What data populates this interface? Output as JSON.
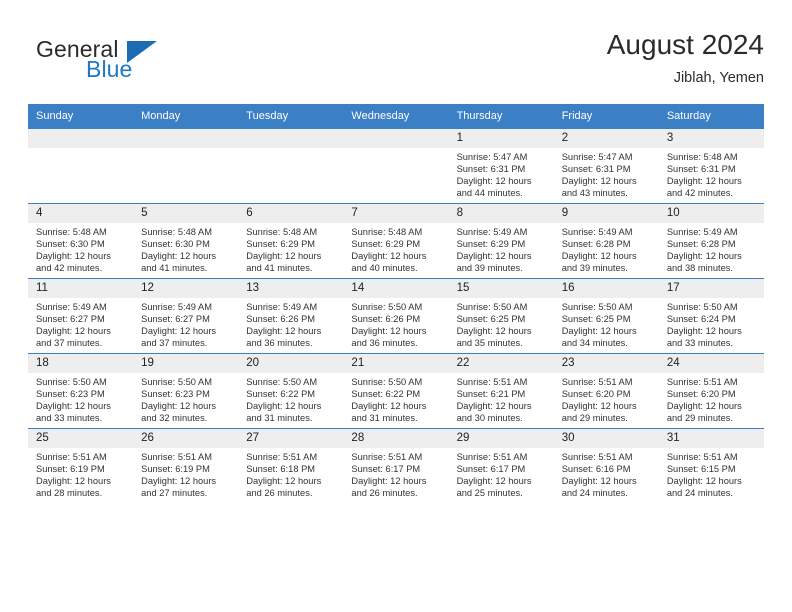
{
  "brand": {
    "name_line1": "General",
    "name_line2": "Blue",
    "flag_icon": "triangle-flag-icon",
    "color_primary": "#1b6cb3",
    "color_text": "#2b2b2b"
  },
  "header": {
    "title": "August 2024",
    "subtitle": "Jiblah, Yemen"
  },
  "calendar": {
    "header_bg": "#3b7fc4",
    "header_text_color": "#ffffff",
    "daynum_bg": "#eeeeee",
    "weekdays": [
      "Sunday",
      "Monday",
      "Tuesday",
      "Wednesday",
      "Thursday",
      "Friday",
      "Saturday"
    ],
    "weeks": [
      [
        {
          "day": "",
          "sunrise": "",
          "sunset": "",
          "daylight1": "",
          "daylight2": ""
        },
        {
          "day": "",
          "sunrise": "",
          "sunset": "",
          "daylight1": "",
          "daylight2": ""
        },
        {
          "day": "",
          "sunrise": "",
          "sunset": "",
          "daylight1": "",
          "daylight2": ""
        },
        {
          "day": "",
          "sunrise": "",
          "sunset": "",
          "daylight1": "",
          "daylight2": ""
        },
        {
          "day": "1",
          "sunrise": "Sunrise: 5:47 AM",
          "sunset": "Sunset: 6:31 PM",
          "daylight1": "Daylight: 12 hours",
          "daylight2": "and 44 minutes."
        },
        {
          "day": "2",
          "sunrise": "Sunrise: 5:47 AM",
          "sunset": "Sunset: 6:31 PM",
          "daylight1": "Daylight: 12 hours",
          "daylight2": "and 43 minutes."
        },
        {
          "day": "3",
          "sunrise": "Sunrise: 5:48 AM",
          "sunset": "Sunset: 6:31 PM",
          "daylight1": "Daylight: 12 hours",
          "daylight2": "and 42 minutes."
        }
      ],
      [
        {
          "day": "4",
          "sunrise": "Sunrise: 5:48 AM",
          "sunset": "Sunset: 6:30 PM",
          "daylight1": "Daylight: 12 hours",
          "daylight2": "and 42 minutes."
        },
        {
          "day": "5",
          "sunrise": "Sunrise: 5:48 AM",
          "sunset": "Sunset: 6:30 PM",
          "daylight1": "Daylight: 12 hours",
          "daylight2": "and 41 minutes."
        },
        {
          "day": "6",
          "sunrise": "Sunrise: 5:48 AM",
          "sunset": "Sunset: 6:29 PM",
          "daylight1": "Daylight: 12 hours",
          "daylight2": "and 41 minutes."
        },
        {
          "day": "7",
          "sunrise": "Sunrise: 5:48 AM",
          "sunset": "Sunset: 6:29 PM",
          "daylight1": "Daylight: 12 hours",
          "daylight2": "and 40 minutes."
        },
        {
          "day": "8",
          "sunrise": "Sunrise: 5:49 AM",
          "sunset": "Sunset: 6:29 PM",
          "daylight1": "Daylight: 12 hours",
          "daylight2": "and 39 minutes."
        },
        {
          "day": "9",
          "sunrise": "Sunrise: 5:49 AM",
          "sunset": "Sunset: 6:28 PM",
          "daylight1": "Daylight: 12 hours",
          "daylight2": "and 39 minutes."
        },
        {
          "day": "10",
          "sunrise": "Sunrise: 5:49 AM",
          "sunset": "Sunset: 6:28 PM",
          "daylight1": "Daylight: 12 hours",
          "daylight2": "and 38 minutes."
        }
      ],
      [
        {
          "day": "11",
          "sunrise": "Sunrise: 5:49 AM",
          "sunset": "Sunset: 6:27 PM",
          "daylight1": "Daylight: 12 hours",
          "daylight2": "and 37 minutes."
        },
        {
          "day": "12",
          "sunrise": "Sunrise: 5:49 AM",
          "sunset": "Sunset: 6:27 PM",
          "daylight1": "Daylight: 12 hours",
          "daylight2": "and 37 minutes."
        },
        {
          "day": "13",
          "sunrise": "Sunrise: 5:49 AM",
          "sunset": "Sunset: 6:26 PM",
          "daylight1": "Daylight: 12 hours",
          "daylight2": "and 36 minutes."
        },
        {
          "day": "14",
          "sunrise": "Sunrise: 5:50 AM",
          "sunset": "Sunset: 6:26 PM",
          "daylight1": "Daylight: 12 hours",
          "daylight2": "and 36 minutes."
        },
        {
          "day": "15",
          "sunrise": "Sunrise: 5:50 AM",
          "sunset": "Sunset: 6:25 PM",
          "daylight1": "Daylight: 12 hours",
          "daylight2": "and 35 minutes."
        },
        {
          "day": "16",
          "sunrise": "Sunrise: 5:50 AM",
          "sunset": "Sunset: 6:25 PM",
          "daylight1": "Daylight: 12 hours",
          "daylight2": "and 34 minutes."
        },
        {
          "day": "17",
          "sunrise": "Sunrise: 5:50 AM",
          "sunset": "Sunset: 6:24 PM",
          "daylight1": "Daylight: 12 hours",
          "daylight2": "and 33 minutes."
        }
      ],
      [
        {
          "day": "18",
          "sunrise": "Sunrise: 5:50 AM",
          "sunset": "Sunset: 6:23 PM",
          "daylight1": "Daylight: 12 hours",
          "daylight2": "and 33 minutes."
        },
        {
          "day": "19",
          "sunrise": "Sunrise: 5:50 AM",
          "sunset": "Sunset: 6:23 PM",
          "daylight1": "Daylight: 12 hours",
          "daylight2": "and 32 minutes."
        },
        {
          "day": "20",
          "sunrise": "Sunrise: 5:50 AM",
          "sunset": "Sunset: 6:22 PM",
          "daylight1": "Daylight: 12 hours",
          "daylight2": "and 31 minutes."
        },
        {
          "day": "21",
          "sunrise": "Sunrise: 5:50 AM",
          "sunset": "Sunset: 6:22 PM",
          "daylight1": "Daylight: 12 hours",
          "daylight2": "and 31 minutes."
        },
        {
          "day": "22",
          "sunrise": "Sunrise: 5:51 AM",
          "sunset": "Sunset: 6:21 PM",
          "daylight1": "Daylight: 12 hours",
          "daylight2": "and 30 minutes."
        },
        {
          "day": "23",
          "sunrise": "Sunrise: 5:51 AM",
          "sunset": "Sunset: 6:20 PM",
          "daylight1": "Daylight: 12 hours",
          "daylight2": "and 29 minutes."
        },
        {
          "day": "24",
          "sunrise": "Sunrise: 5:51 AM",
          "sunset": "Sunset: 6:20 PM",
          "daylight1": "Daylight: 12 hours",
          "daylight2": "and 29 minutes."
        }
      ],
      [
        {
          "day": "25",
          "sunrise": "Sunrise: 5:51 AM",
          "sunset": "Sunset: 6:19 PM",
          "daylight1": "Daylight: 12 hours",
          "daylight2": "and 28 minutes."
        },
        {
          "day": "26",
          "sunrise": "Sunrise: 5:51 AM",
          "sunset": "Sunset: 6:19 PM",
          "daylight1": "Daylight: 12 hours",
          "daylight2": "and 27 minutes."
        },
        {
          "day": "27",
          "sunrise": "Sunrise: 5:51 AM",
          "sunset": "Sunset: 6:18 PM",
          "daylight1": "Daylight: 12 hours",
          "daylight2": "and 26 minutes."
        },
        {
          "day": "28",
          "sunrise": "Sunrise: 5:51 AM",
          "sunset": "Sunset: 6:17 PM",
          "daylight1": "Daylight: 12 hours",
          "daylight2": "and 26 minutes."
        },
        {
          "day": "29",
          "sunrise": "Sunrise: 5:51 AM",
          "sunset": "Sunset: 6:17 PM",
          "daylight1": "Daylight: 12 hours",
          "daylight2": "and 25 minutes."
        },
        {
          "day": "30",
          "sunrise": "Sunrise: 5:51 AM",
          "sunset": "Sunset: 6:16 PM",
          "daylight1": "Daylight: 12 hours",
          "daylight2": "and 24 minutes."
        },
        {
          "day": "31",
          "sunrise": "Sunrise: 5:51 AM",
          "sunset": "Sunset: 6:15 PM",
          "daylight1": "Daylight: 12 hours",
          "daylight2": "and 24 minutes."
        }
      ]
    ]
  }
}
